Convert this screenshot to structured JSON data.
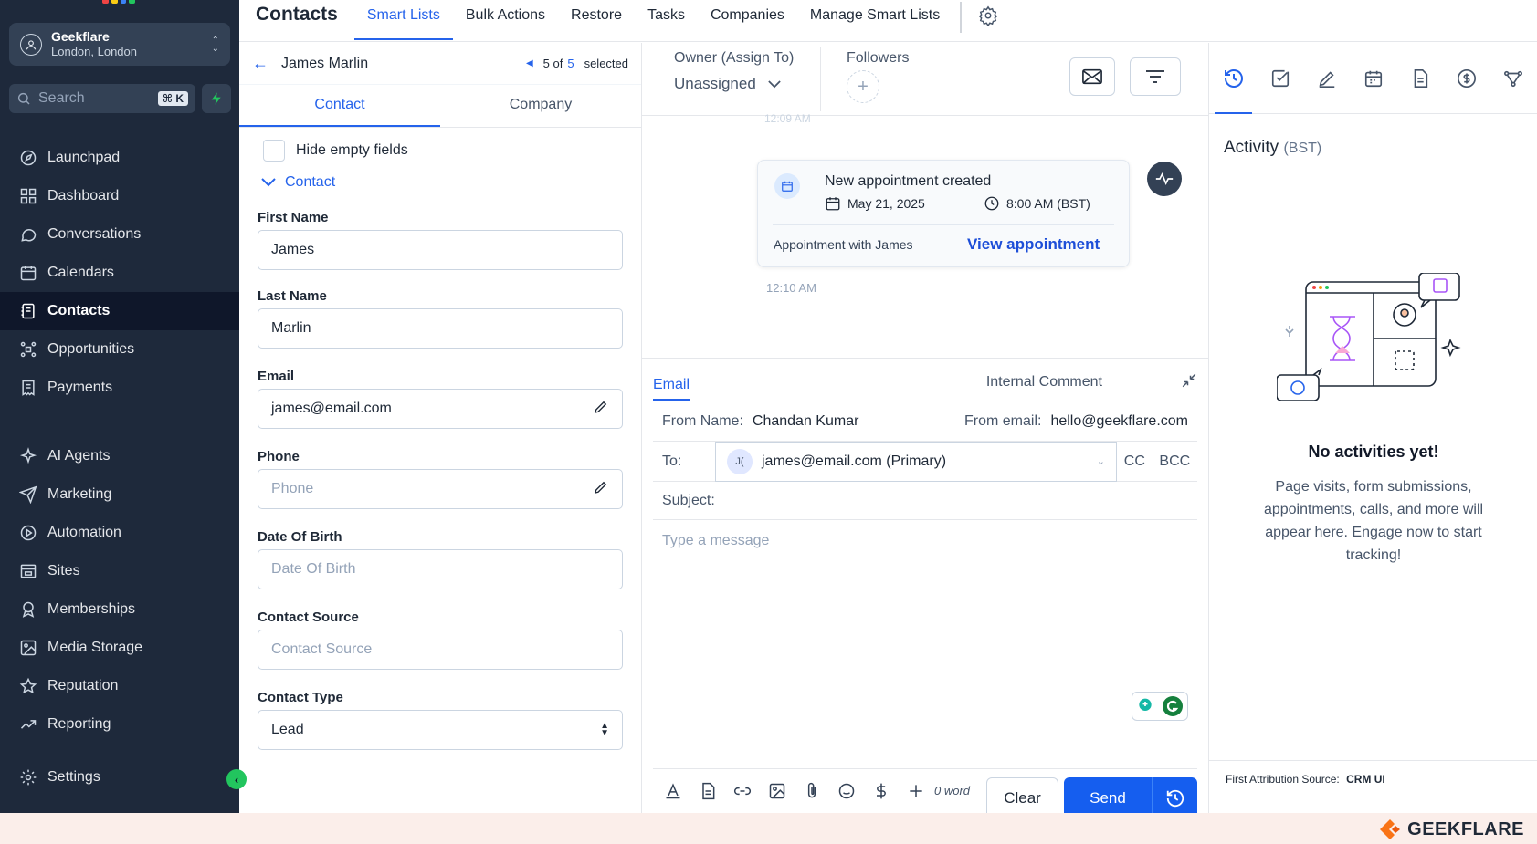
{
  "sidebar": {
    "account_name": "Geekflare",
    "account_location": "London, London",
    "search_placeholder": "Search",
    "search_shortcut": "⌘ K",
    "items": [
      {
        "label": "Launchpad"
      },
      {
        "label": "Dashboard"
      },
      {
        "label": "Conversations"
      },
      {
        "label": "Calendars"
      },
      {
        "label": "Contacts"
      },
      {
        "label": "Opportunities"
      },
      {
        "label": "Payments"
      }
    ],
    "items2": [
      {
        "label": "AI Agents"
      },
      {
        "label": "Marketing"
      },
      {
        "label": "Automation"
      },
      {
        "label": "Sites"
      },
      {
        "label": "Memberships"
      },
      {
        "label": "Media Storage"
      },
      {
        "label": "Reputation"
      },
      {
        "label": "Reporting"
      }
    ],
    "settings_label": "Settings"
  },
  "topbar": {
    "title": "Contacts",
    "tabs": [
      "Smart Lists",
      "Bulk Actions",
      "Restore",
      "Tasks",
      "Companies",
      "Manage Smart Lists"
    ]
  },
  "details": {
    "contact_name": "James Marlin",
    "pager_current": "5 of",
    "pager_total": "5",
    "pager_suffix": "selected",
    "tabs": [
      "Contact",
      "Company"
    ],
    "hide_empty_label": "Hide empty fields",
    "section_label": "Contact",
    "fields": {
      "first_name_label": "First Name",
      "first_name_value": "James",
      "last_name_label": "Last Name",
      "last_name_value": "Marlin",
      "email_label": "Email",
      "email_value": "james@email.com",
      "phone_label": "Phone",
      "phone_placeholder": "Phone",
      "dob_label": "Date Of Birth",
      "dob_placeholder": "Date Of Birth",
      "source_label": "Contact Source",
      "source_placeholder": "Contact Source",
      "type_label": "Contact Type",
      "type_value": "Lead"
    }
  },
  "convo": {
    "owner_label": "Owner (Assign To)",
    "owner_value": "Unassigned",
    "followers_label": "Followers",
    "faded_timestamp": "12:09 AM",
    "appointment": {
      "title": "New appointment created",
      "date": "May 21, 2025",
      "time": "8:00 AM (BST)",
      "with": "Appointment with James",
      "link": "View appointment"
    },
    "timestamp": "12:10 AM",
    "composer": {
      "tab_email": "Email",
      "tab_internal": "Internal Comment",
      "from_name_label": "From Name:",
      "from_name_value": "Chandan Kumar",
      "from_email_label": "From email:",
      "from_email_value": "hello@geekflare.com",
      "to_label": "To:",
      "to_initials": "J(",
      "to_value": "james@email.com (Primary)",
      "cc": "CC",
      "bcc": "BCC",
      "subject_label": "Subject:",
      "message_placeholder": "Type a message",
      "word_count": "0 word",
      "clear_label": "Clear",
      "send_label": "Send"
    }
  },
  "activity": {
    "title": "Activity",
    "tz": "(BST)",
    "empty_title": "No activities yet!",
    "empty_desc": "Page visits, form submissions, appointments, calls, and more will appear here. Engage now to start tracking!",
    "attrib_label": "First Attribution Source:",
    "attrib_value": "CRM UI"
  },
  "footer": {
    "brand": "GEEKFLARE"
  },
  "colors": {
    "sidebar": "#1e293b",
    "accent": "#2563eb",
    "send": "#155eef",
    "brand": "#f97316"
  }
}
